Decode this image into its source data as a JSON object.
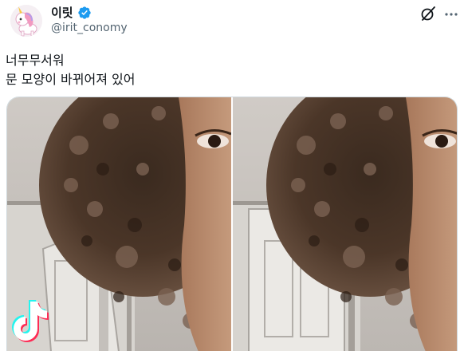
{
  "tweet": {
    "display_name": "이릿",
    "handle": "@irit_conomy",
    "text_lines": [
      "너무무서워",
      "문 모양이 바뀌어져 있어"
    ]
  },
  "icons": {
    "avatar": "unicorn-avatar",
    "verified": "verified-badge-icon",
    "grok": "grok-icon",
    "more": "more-options-icon",
    "tiktok": "tiktok-logo"
  },
  "colors": {
    "verified_blue": "#1d9bf0",
    "text_primary": "#0f1419",
    "text_secondary": "#536471",
    "border": "#cfd9de"
  }
}
